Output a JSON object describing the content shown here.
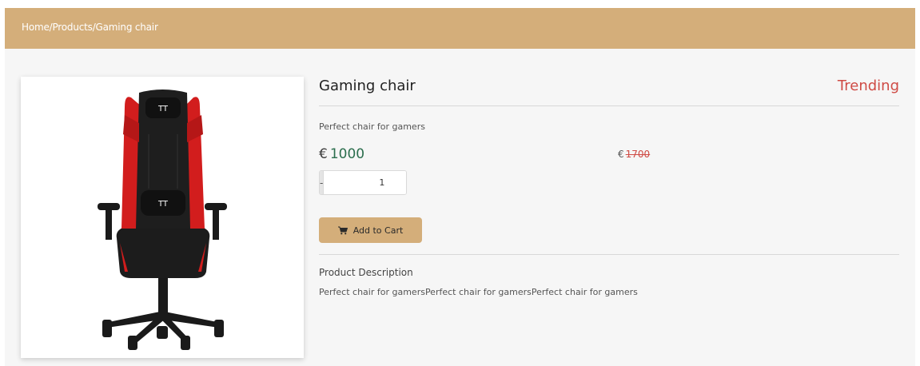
{
  "breadcrumb": {
    "text": "Home/Products/Gaming chair"
  },
  "product": {
    "image_alt": "Gaming chair image",
    "title": "Gaming chair",
    "badge": "Trending",
    "subtitle": "Perfect chair for gamers",
    "currency": "€",
    "price": "1000",
    "old_price": "1700",
    "quantity": {
      "minus": "-",
      "value": "1",
      "plus": "+"
    },
    "add_to_cart": "Add to Cart",
    "description_heading": "Product Description",
    "description_text": "Perfect chair for gamersPerfect chair for gamersPerfect chair for gamers"
  },
  "icons": {
    "cart": "shopping-cart-icon"
  },
  "colors": {
    "accent": "#d4ae7a",
    "price": "#2b6e4d",
    "badge": "#cf4b45",
    "background": "#f6f6f6"
  }
}
